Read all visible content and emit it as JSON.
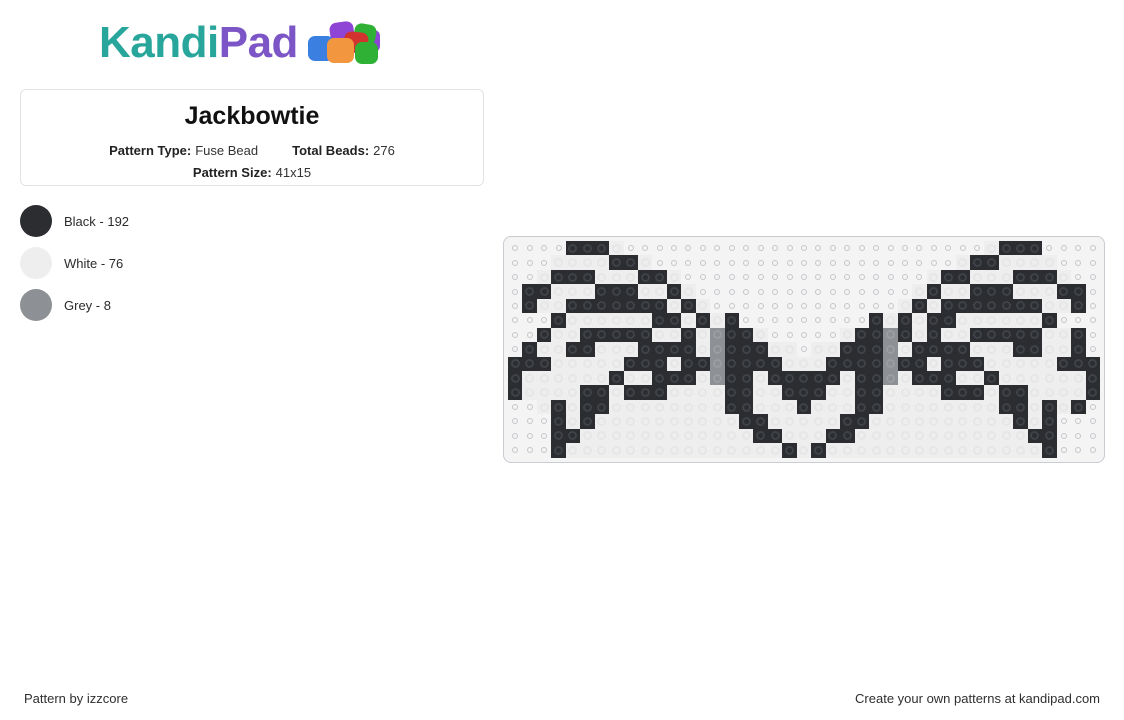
{
  "brand": {
    "name_part1": "Kandi",
    "name_part2": "Pad",
    "logo_icon": "kandi-beads-icon",
    "color_teal": "#29a69b",
    "color_purple": "#7c56c6"
  },
  "pattern": {
    "title": "Jackbowtie",
    "type_label": "Pattern Type:",
    "type_value": "Fuse Bead",
    "total_label": "Total Beads:",
    "total_value": "276",
    "size_label": "Pattern Size:",
    "size_value": "41x15"
  },
  "legend": [
    {
      "name": "Black",
      "count": 192,
      "label": "Black - 192",
      "color": "#2b2d31"
    },
    {
      "name": "White",
      "count": 76,
      "label": "White - 76",
      "color": "#eeeeee"
    },
    {
      "name": "Grey",
      "count": 8,
      "label": "Grey - 8",
      "color": "#8d9094"
    }
  ],
  "grid": {
    "cols": 41,
    "rows": 15,
    "key": {
      "0": "empty",
      "1": "black",
      "2": "white",
      "3": "grey"
    },
    "palette": {
      "empty": "#f4f4f4",
      "black": "#2b2d31",
      "white": "#eeeeee",
      "grey": "#8d9094"
    },
    "cells": [
      [
        0,
        0,
        0,
        0,
        1,
        1,
        1,
        2,
        0,
        0,
        0,
        0,
        0,
        0,
        0,
        0,
        0,
        0,
        0,
        0,
        0,
        0,
        0,
        0,
        0,
        0,
        0,
        0,
        0,
        0,
        0,
        0,
        0,
        2,
        1,
        1,
        1,
        0,
        0,
        0,
        0
      ],
      [
        0,
        0,
        0,
        2,
        2,
        2,
        2,
        1,
        1,
        2,
        0,
        0,
        0,
        0,
        0,
        0,
        0,
        0,
        0,
        0,
        0,
        0,
        0,
        0,
        0,
        0,
        0,
        0,
        0,
        0,
        0,
        2,
        1,
        1,
        2,
        2,
        2,
        2,
        0,
        0,
        0
      ],
      [
        0,
        0,
        2,
        1,
        1,
        1,
        2,
        2,
        2,
        1,
        1,
        2,
        0,
        0,
        0,
        0,
        0,
        0,
        0,
        0,
        0,
        0,
        0,
        0,
        0,
        0,
        0,
        0,
        0,
        2,
        1,
        1,
        2,
        2,
        2,
        1,
        1,
        1,
        2,
        0,
        0
      ],
      [
        0,
        1,
        1,
        2,
        2,
        2,
        1,
        1,
        1,
        2,
        2,
        1,
        2,
        0,
        0,
        0,
        0,
        0,
        0,
        0,
        0,
        0,
        0,
        0,
        0,
        0,
        0,
        0,
        2,
        1,
        2,
        2,
        1,
        1,
        1,
        2,
        2,
        2,
        1,
        1,
        0
      ],
      [
        0,
        1,
        2,
        2,
        1,
        1,
        1,
        1,
        1,
        1,
        1,
        2,
        1,
        2,
        0,
        0,
        0,
        0,
        0,
        0,
        0,
        0,
        0,
        0,
        0,
        0,
        0,
        2,
        1,
        2,
        1,
        1,
        1,
        1,
        1,
        1,
        1,
        2,
        2,
        1,
        0
      ],
      [
        0,
        0,
        0,
        1,
        2,
        2,
        2,
        2,
        2,
        2,
        1,
        1,
        2,
        1,
        2,
        1,
        0,
        0,
        0,
        0,
        0,
        0,
        0,
        0,
        0,
        1,
        2,
        1,
        2,
        1,
        1,
        2,
        2,
        2,
        2,
        2,
        2,
        1,
        0,
        0,
        0
      ],
      [
        0,
        0,
        1,
        2,
        2,
        1,
        1,
        1,
        1,
        1,
        2,
        2,
        1,
        2,
        3,
        1,
        1,
        2,
        0,
        0,
        0,
        0,
        0,
        2,
        1,
        1,
        3,
        1,
        2,
        1,
        2,
        2,
        1,
        1,
        1,
        1,
        1,
        2,
        2,
        1,
        0
      ],
      [
        0,
        1,
        2,
        2,
        1,
        1,
        2,
        2,
        2,
        1,
        1,
        1,
        1,
        2,
        3,
        1,
        1,
        1,
        2,
        2,
        0,
        2,
        2,
        1,
        1,
        1,
        3,
        2,
        1,
        1,
        1,
        1,
        2,
        2,
        2,
        1,
        1,
        2,
        2,
        1,
        0
      ],
      [
        1,
        1,
        1,
        2,
        2,
        2,
        2,
        2,
        1,
        1,
        1,
        2,
        1,
        1,
        3,
        1,
        1,
        1,
        1,
        2,
        2,
        2,
        1,
        1,
        1,
        1,
        3,
        1,
        1,
        2,
        1,
        1,
        1,
        2,
        2,
        2,
        2,
        2,
        1,
        1,
        1
      ],
      [
        1,
        2,
        2,
        2,
        2,
        2,
        2,
        1,
        2,
        2,
        1,
        1,
        1,
        2,
        3,
        1,
        1,
        2,
        1,
        1,
        1,
        1,
        1,
        2,
        1,
        1,
        3,
        2,
        1,
        1,
        1,
        2,
        2,
        1,
        2,
        2,
        2,
        2,
        2,
        2,
        1
      ],
      [
        1,
        2,
        2,
        2,
        2,
        1,
        1,
        2,
        1,
        1,
        1,
        2,
        2,
        2,
        2,
        1,
        1,
        2,
        2,
        1,
        1,
        1,
        2,
        2,
        1,
        1,
        2,
        2,
        2,
        2,
        1,
        1,
        1,
        2,
        1,
        1,
        2,
        2,
        2,
        2,
        1
      ],
      [
        0,
        0,
        2,
        1,
        2,
        1,
        1,
        2,
        2,
        2,
        2,
        2,
        2,
        2,
        2,
        1,
        1,
        2,
        2,
        2,
        1,
        2,
        2,
        2,
        1,
        1,
        2,
        2,
        2,
        2,
        2,
        2,
        2,
        2,
        1,
        1,
        2,
        1,
        2,
        1,
        0
      ],
      [
        0,
        0,
        0,
        1,
        2,
        1,
        2,
        2,
        2,
        2,
        2,
        2,
        2,
        2,
        2,
        2,
        1,
        1,
        2,
        2,
        2,
        2,
        2,
        1,
        1,
        2,
        2,
        2,
        2,
        2,
        2,
        2,
        2,
        2,
        2,
        1,
        2,
        1,
        0,
        0,
        0
      ],
      [
        0,
        0,
        0,
        1,
        1,
        2,
        2,
        2,
        2,
        2,
        2,
        2,
        2,
        2,
        2,
        2,
        2,
        1,
        1,
        2,
        2,
        2,
        1,
        1,
        2,
        2,
        2,
        2,
        2,
        2,
        2,
        2,
        2,
        2,
        2,
        2,
        1,
        1,
        0,
        0,
        0
      ],
      [
        0,
        0,
        0,
        1,
        2,
        2,
        2,
        2,
        2,
        2,
        2,
        2,
        2,
        2,
        2,
        2,
        2,
        2,
        2,
        1,
        2,
        1,
        2,
        2,
        2,
        2,
        2,
        2,
        2,
        2,
        2,
        2,
        2,
        2,
        2,
        2,
        2,
        1,
        0,
        0,
        0
      ]
    ]
  },
  "footer": {
    "left": "Pattern by izzcore",
    "right": "Create your own patterns at kandipad.com"
  }
}
